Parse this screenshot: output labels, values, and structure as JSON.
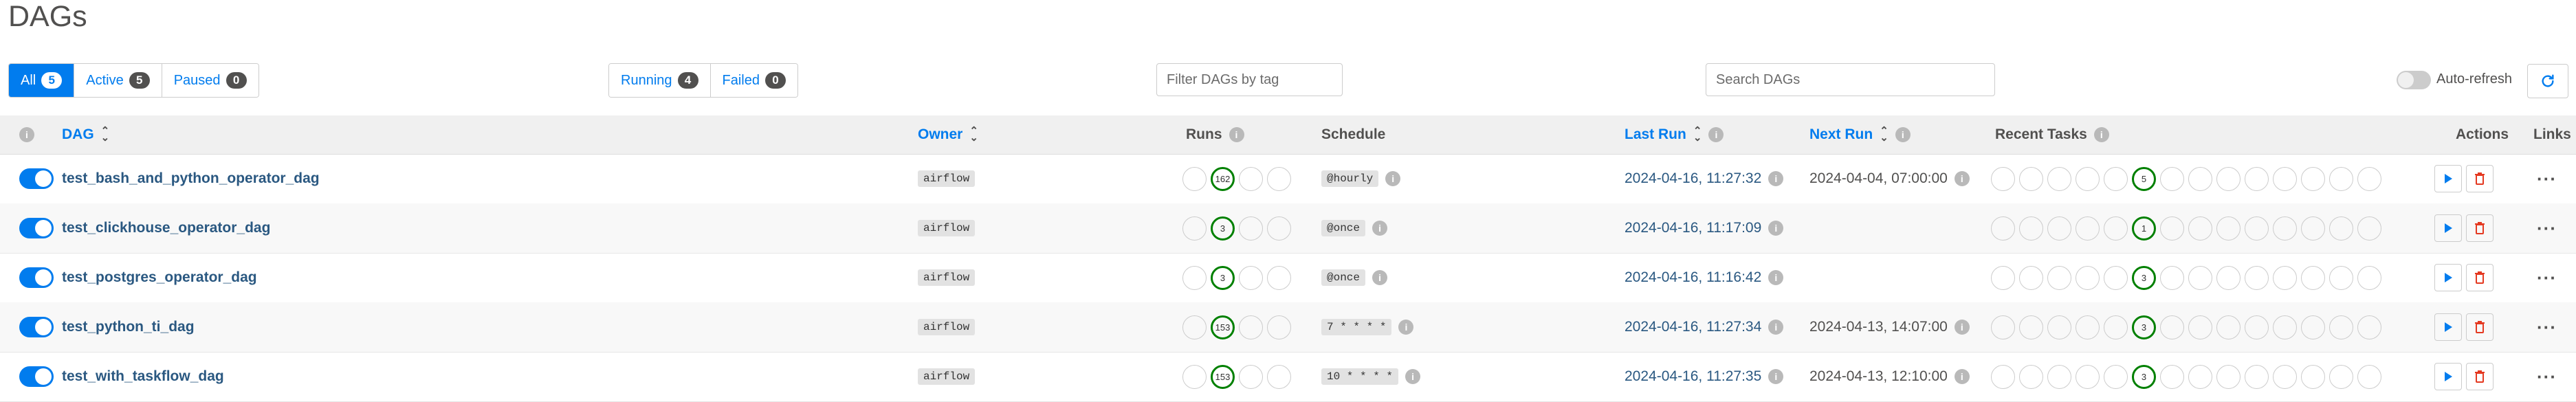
{
  "page": {
    "title": "DAGs"
  },
  "status_filter": [
    {
      "label": "All",
      "count": "5",
      "active": true
    },
    {
      "label": "Active",
      "count": "5"
    },
    {
      "label": "Paused",
      "count": "0"
    }
  ],
  "run_filter": [
    {
      "label": "Running",
      "count": "4"
    },
    {
      "label": "Failed",
      "count": "0"
    }
  ],
  "tag_filter": {
    "placeholder": "Filter DAGs by tag"
  },
  "search": {
    "placeholder": "Search DAGs"
  },
  "auto_refresh": {
    "label": "Auto-refresh",
    "enabled": false
  },
  "colors": {
    "accent": "#017cee",
    "success": "#008000",
    "danger": "#e43921"
  },
  "columns": {
    "dag": "DAG",
    "owner": "Owner",
    "runs": "Runs",
    "schedule": "Schedule",
    "last_run": "Last Run",
    "next_run": "Next Run",
    "recent_tasks": "Recent Tasks",
    "actions": "Actions",
    "links": "Links"
  },
  "info_glyph": "i",
  "rows": [
    {
      "dag_id": "test_bash_and_python_operator_dag",
      "owner": "airflow",
      "runs_success": "162",
      "schedule": "@hourly",
      "last_run": "2024-04-16, 11:27:32",
      "next_run": "2024-04-04, 07:00:00",
      "recent_success": "5"
    },
    {
      "dag_id": "test_clickhouse_operator_dag",
      "owner": "airflow",
      "runs_success": "3",
      "schedule": "@once",
      "last_run": "2024-04-16, 11:17:09",
      "next_run": "",
      "recent_success": "1"
    },
    {
      "dag_id": "test_postgres_operator_dag",
      "owner": "airflow",
      "runs_success": "3",
      "schedule": "@once",
      "last_run": "2024-04-16, 11:16:42",
      "next_run": "",
      "recent_success": "3"
    },
    {
      "dag_id": "test_python_ti_dag",
      "owner": "airflow",
      "runs_success": "153",
      "schedule": "7 * * * *",
      "last_run": "2024-04-16, 11:27:34",
      "next_run": "2024-04-13, 14:07:00",
      "recent_success": "3"
    },
    {
      "dag_id": "test_with_taskflow_dag",
      "owner": "airflow",
      "runs_success": "153",
      "schedule": "10 * * * *",
      "last_run": "2024-04-16, 11:27:35",
      "next_run": "2024-04-13, 12:10:00",
      "recent_success": "3"
    }
  ]
}
